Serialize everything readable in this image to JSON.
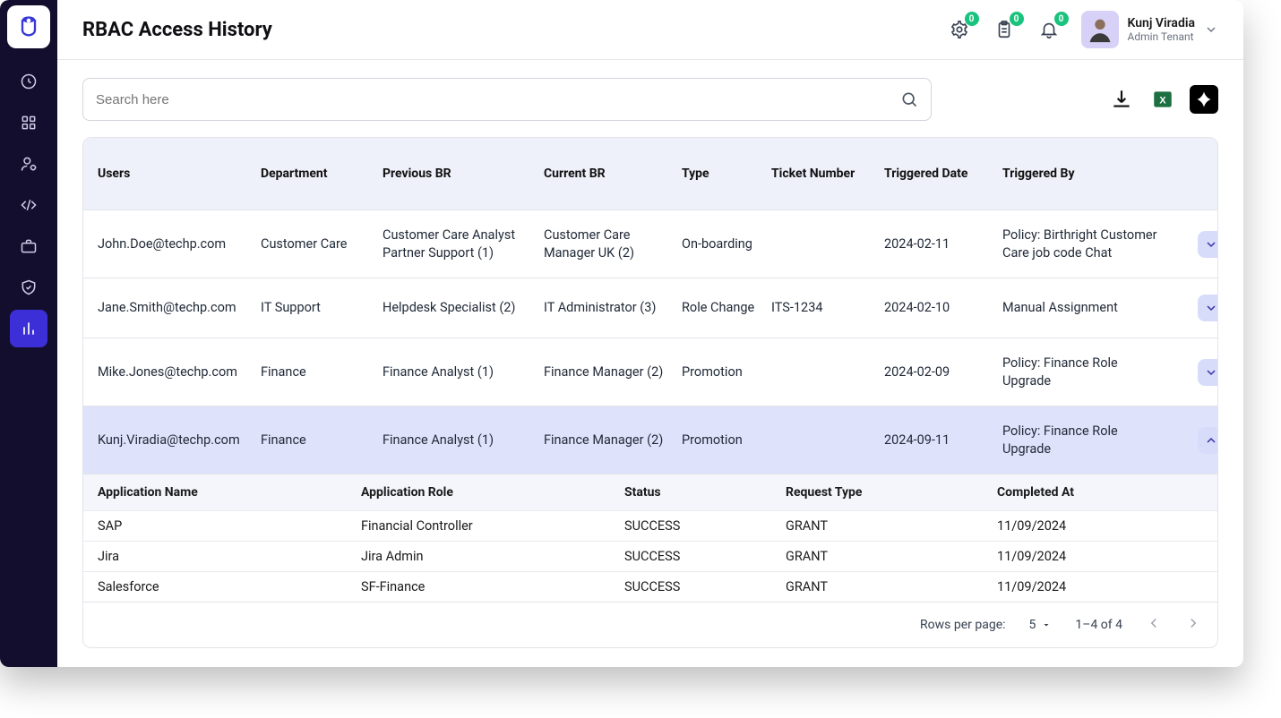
{
  "header": {
    "title": "RBAC Access History",
    "badges": {
      "settings": "0",
      "clipboard": "0",
      "bell": "0"
    },
    "user": {
      "name": "Kunj Viradia",
      "role": "Admin Tenant"
    }
  },
  "search": {
    "placeholder": "Search here"
  },
  "table": {
    "columns": [
      "Users",
      "Department",
      "Previous BR",
      "Current BR",
      "Type",
      "Ticket Number",
      "Triggered Date",
      "Triggered By"
    ],
    "rows": [
      {
        "user": "John.Doe@techp.com",
        "dept": "Customer Care",
        "prev": "Customer Care Analyst Partner Support (1)",
        "curr": "Customer Care Manager UK (2)",
        "type": "On-boarding",
        "ticket": "",
        "date": "2024-02-11",
        "by": "Policy: Birthright Customer Care job code Chat",
        "expanded": false
      },
      {
        "user": "Jane.Smith@techp.com",
        "dept": "IT Support",
        "prev": "Helpdesk Specialist (2)",
        "curr": "IT Administrator (3)",
        "type": "Role Change",
        "ticket": "ITS-1234",
        "date": "2024-02-10",
        "by": "Manual Assignment",
        "expanded": false
      },
      {
        "user": "Mike.Jones@techp.com",
        "dept": "Finance",
        "prev": "Finance Analyst (1)",
        "curr": "Finance Manager (2)",
        "type": "Promotion",
        "ticket": "",
        "date": "2024-02-09",
        "by": "Policy: Finance Role Upgrade",
        "expanded": false
      },
      {
        "user": "Kunj.Viradia@techp.com",
        "dept": "Finance",
        "prev": "Finance Analyst (1)",
        "curr": "Finance Manager (2)",
        "type": "Promotion",
        "ticket": "",
        "date": "2024-09-11",
        "by": "Policy: Finance Role Upgrade",
        "expanded": true
      }
    ]
  },
  "nested": {
    "columns": [
      "Application Name",
      "Application Role",
      "Status",
      "Request Type",
      "Completed At"
    ],
    "rows": [
      {
        "app": "SAP",
        "role": "Financial Controller",
        "status": "SUCCESS",
        "req": "GRANT",
        "completed": "11/09/2024"
      },
      {
        "app": "Jira",
        "role": "Jira Admin",
        "status": "SUCCESS",
        "req": "GRANT",
        "completed": "11/09/2024"
      },
      {
        "app": "Salesforce",
        "role": "SF-Finance",
        "status": "SUCCESS",
        "req": "GRANT",
        "completed": "11/09/2024"
      }
    ]
  },
  "pagination": {
    "label": "Rows per page:",
    "per_page": "5",
    "range": "1–4 of 4"
  }
}
